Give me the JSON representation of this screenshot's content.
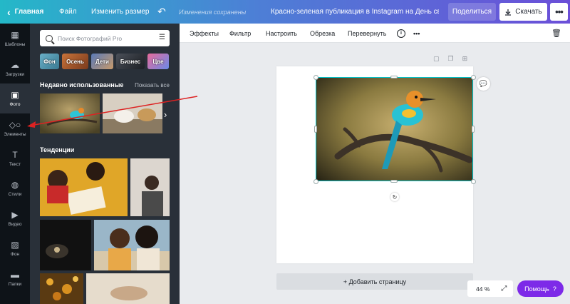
{
  "topbar": {
    "back_label": "Главная",
    "file_label": "Файл",
    "resize_label": "Изменить размер",
    "saved_status": "Изменения сохранены",
    "document_title": "Красно-зеленая публикация в Instagram на День свято...",
    "share_label": "Поделиться",
    "download_label": "Скачать",
    "more_label": "•••"
  },
  "rail": {
    "items": [
      {
        "label": "Шаблоны",
        "icon": "grid-icon"
      },
      {
        "label": "Загрузки",
        "icon": "cloud-upload-icon"
      },
      {
        "label": "Фото",
        "icon": "image-icon"
      },
      {
        "label": "Элементы",
        "icon": "shapes-icon"
      },
      {
        "label": "Текст",
        "icon": "text-icon"
      },
      {
        "label": "Стили",
        "icon": "palette-icon"
      },
      {
        "label": "Видео",
        "icon": "video-icon"
      },
      {
        "label": "Фон",
        "icon": "pattern-icon"
      },
      {
        "label": "Папки",
        "icon": "folder-icon"
      }
    ],
    "active_index": 2
  },
  "panel": {
    "search_placeholder": "Поиск Фотографий Pro",
    "chips": [
      "Фон",
      "Осень",
      "Дети",
      "Бизнес",
      "Цве"
    ],
    "recent_title": "Недавно использованные",
    "show_all": "Показать все",
    "trends_title": "Тенденции"
  },
  "toolbar": {
    "effects": "Эффекты",
    "filter": "Фильтр",
    "adjust": "Настроить",
    "crop": "Обрезка",
    "flip": "Перевернуть",
    "info": "i",
    "more": "•••"
  },
  "canvas": {
    "add_page": "+ Добавить страницу",
    "zoom": "44 %",
    "help": "Помощь",
    "help_icon": "?"
  },
  "colors": {
    "accent_cyan": "#00c4cc",
    "help_purple": "#7d2ae8",
    "panel_bg": "#293039",
    "rail_bg": "#0e1318"
  }
}
